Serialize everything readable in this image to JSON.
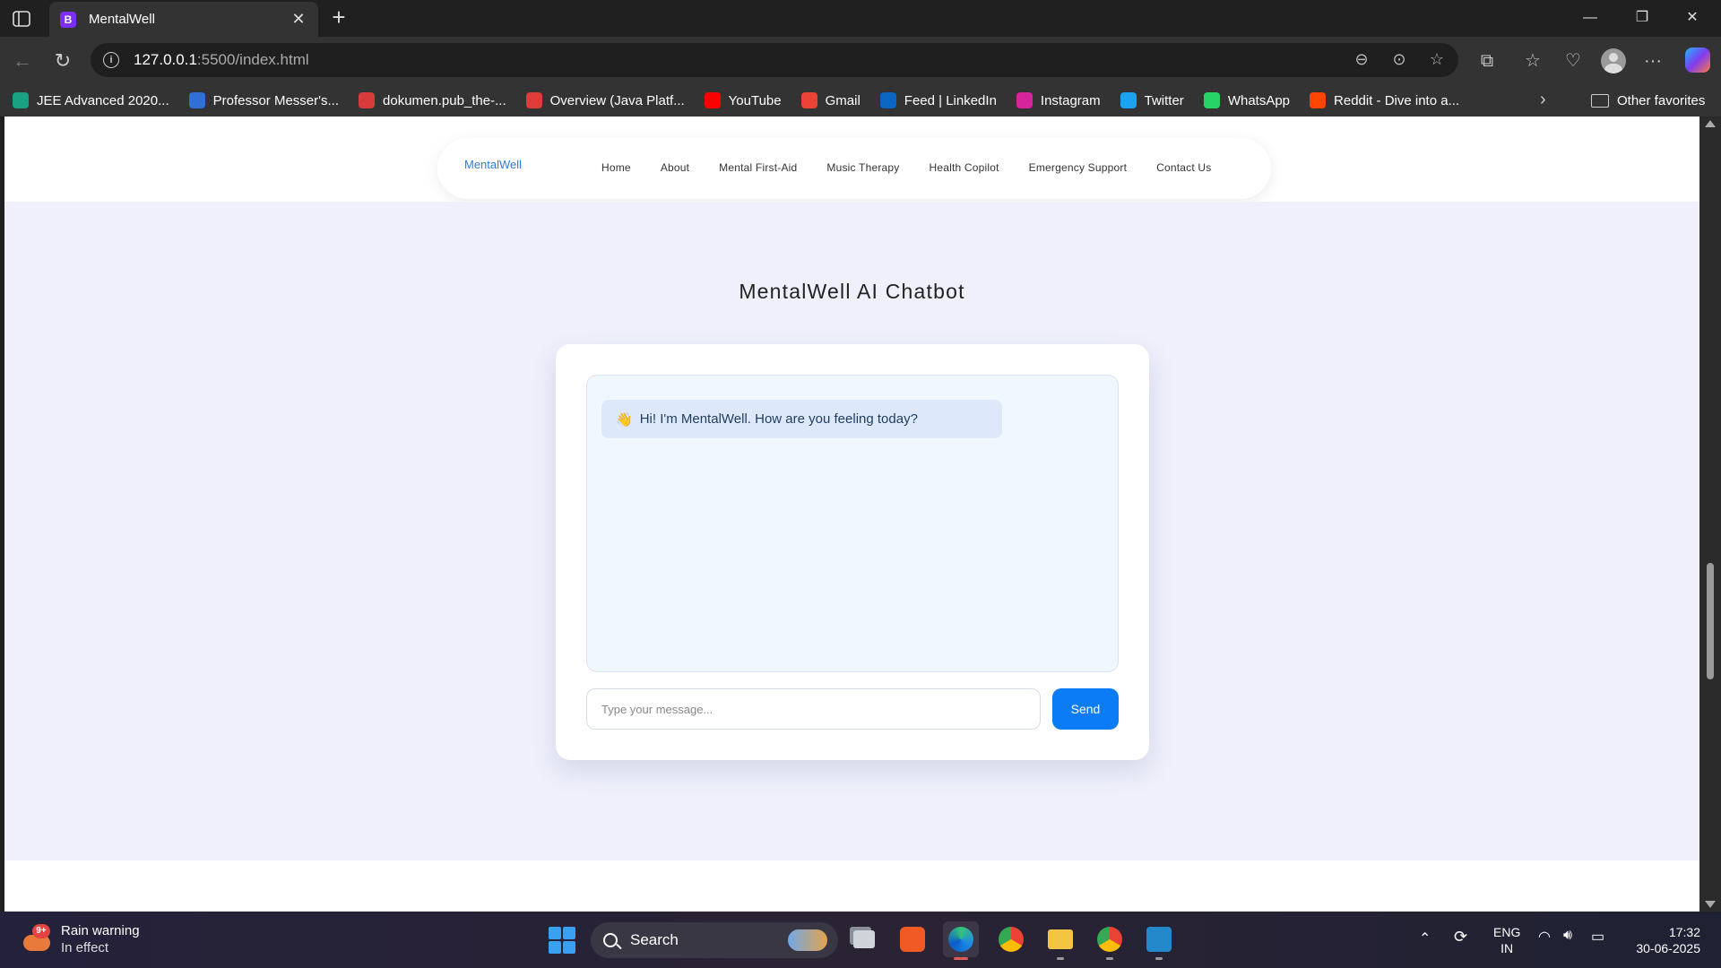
{
  "browser": {
    "tab_title": "MentalWell",
    "tab_favicon_letter": "B",
    "url_host": "127.0.0.1",
    "url_rest": ":5500/index.html",
    "bookmarks": [
      {
        "label": "JEE Advanced 2020...",
        "color": "#1aa184",
        "icon": "jee-icon"
      },
      {
        "label": "Professor Messer's...",
        "color": "#2f6fd6",
        "icon": "professor-messer-icon"
      },
      {
        "label": "dokumen.pub_the-...",
        "color": "#d93a3a",
        "icon": "pdf-icon"
      },
      {
        "label": "Overview (Java Platf...",
        "color": "#e23b3b",
        "icon": "oracle-icon"
      },
      {
        "label": "YouTube",
        "color": "#ff0000",
        "icon": "youtube-icon"
      },
      {
        "label": "Gmail",
        "color": "#ea4335",
        "icon": "gmail-icon"
      },
      {
        "label": "Feed | LinkedIn",
        "color": "#0a66c2",
        "icon": "linkedin-icon"
      },
      {
        "label": "Instagram",
        "color": "#d6249f",
        "icon": "instagram-icon"
      },
      {
        "label": "Twitter",
        "color": "#1da1f2",
        "icon": "twitter-icon"
      },
      {
        "label": "WhatsApp",
        "color": "#25d366",
        "icon": "whatsapp-icon"
      },
      {
        "label": "Reddit - Dive into a...",
        "color": "#ff4500",
        "icon": "reddit-icon"
      }
    ],
    "other_favorites": "Other favorites"
  },
  "page": {
    "brand": "MentalWell",
    "nav": [
      "Home",
      "About",
      "Mental First-Aid",
      "Music Therapy",
      "Health Copilot",
      "Emergency Support",
      "Contact Us"
    ],
    "title": "MentalWell AI Chatbot",
    "bot_message": "Hi! I'm MentalWell. How are you feeling today?",
    "bot_message_emoji": "👋",
    "input_placeholder": "Type your message...",
    "send_label": "Send"
  },
  "taskbar": {
    "weather_title": "Rain warning",
    "weather_sub": "In effect",
    "weather_badge": "9+",
    "search_label": "Search",
    "lang_top": "ENG",
    "lang_bottom": "IN",
    "time": "17:32",
    "date": "30-06-2025"
  },
  "colors": {
    "accent": "#0b7cf5",
    "brand": "#2f7bd8",
    "page_bg": "#eff0fb",
    "chat_bg": "#f1f7ff",
    "bubble_bg": "#dde9fb"
  }
}
